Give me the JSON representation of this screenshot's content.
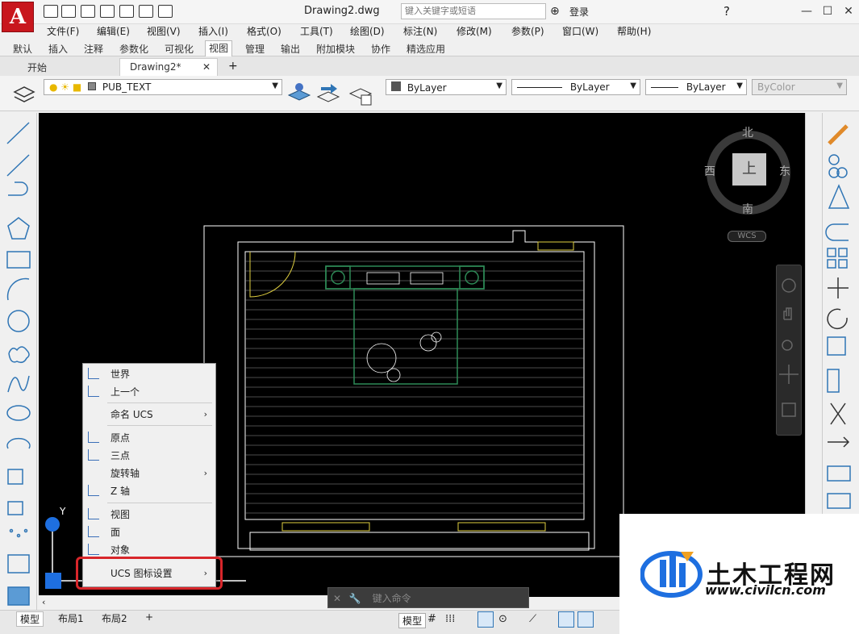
{
  "app": {
    "title": "Drawing2.dwg",
    "search_placeholder": "键入关键字或短语",
    "login": "登录"
  },
  "menus": [
    "文件(F)",
    "编辑(E)",
    "视图(V)",
    "插入(I)",
    "格式(O)",
    "工具(T)",
    "绘图(D)",
    "标注(N)",
    "修改(M)",
    "参数(P)",
    "窗口(W)",
    "帮助(H)"
  ],
  "ribbon_tabs": [
    "默认",
    "插入",
    "注释",
    "参数化",
    "可视化",
    "视图",
    "管理",
    "输出",
    "附加模块",
    "协作",
    "精选应用"
  ],
  "ribbon_active": "视图",
  "doc_tabs": {
    "start": "开始",
    "current": "Drawing2*",
    "close": "✕",
    "add": "+"
  },
  "toolbar": {
    "layer": "PUB_TEXT",
    "color": "ByLayer",
    "linetype": "ByLayer",
    "lineweight": "ByLayer",
    "plotstyle": "ByColor"
  },
  "viewcube": {
    "north": "北",
    "south": "南",
    "east": "东",
    "west": "西",
    "face": "上",
    "wcs": "WCS"
  },
  "context_menu": {
    "world": "世界",
    "previous": "上一个",
    "named_ucs": "命名 UCS",
    "origin": "原点",
    "three_point": "三点",
    "rotate_axis": "旋转轴",
    "z_axis": "Z 轴",
    "view": "视图",
    "face": "面",
    "object": "对象",
    "ucs_icon_settings": "UCS 图标设置"
  },
  "status": {
    "model_tab": "模型",
    "layout1": "布局1",
    "layout2": "布局2",
    "add": "+",
    "model_btn": "模型"
  },
  "command_placeholder": "键入命令",
  "watermark": {
    "name": "土木工程网",
    "url": "www.civilcn.com"
  },
  "colors": {
    "accent": "#c8161d",
    "highlight": "#d8262b",
    "canvas": "#000000",
    "floor_outline": "#ffffff",
    "furniture": "#2e8b57",
    "yellow": "#e0d040"
  }
}
